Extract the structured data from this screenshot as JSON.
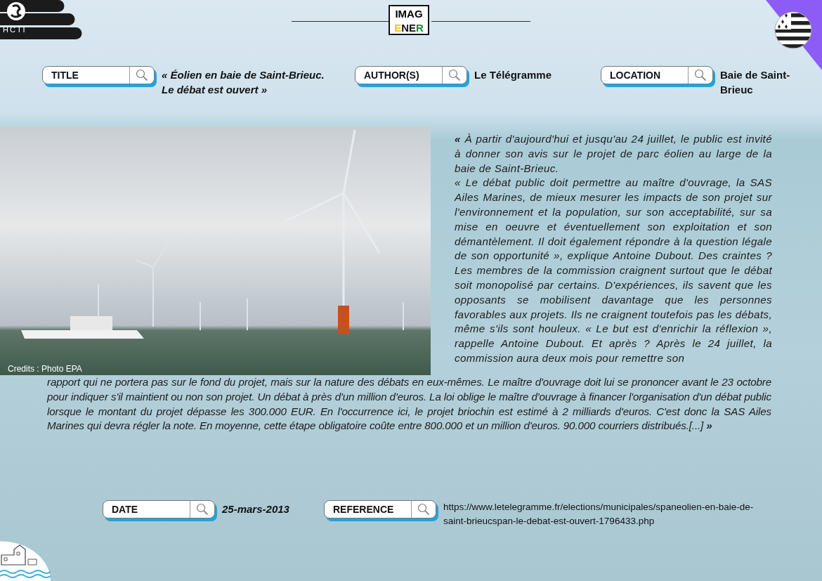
{
  "logo_left": {
    "text": "HCTI"
  },
  "logo_center": {
    "line1": "IMAG",
    "line2": [
      {
        "text": "E",
        "color": "#f0c419"
      },
      {
        "text": "NE",
        "color": "#111111"
      },
      {
        "text": "R",
        "color": "#1f8a3b"
      }
    ]
  },
  "top_fields": [
    {
      "label": "TITLE",
      "value": "« Éolien en baie de Saint-Brieuc. Le débat est ouvert »",
      "italic": true
    },
    {
      "label": "AUTHOR(S)",
      "value": "Le Télégramme",
      "italic": false
    },
    {
      "label": "LOCATION",
      "value": "Baie de Saint-Brieuc",
      "italic": false
    }
  ],
  "photo": {
    "credit": "Credits : Photo EPA"
  },
  "article": {
    "beside_photo": [
      "**«** À partir d'aujourd'hui et jusqu'au 24 juillet, le public est invité à donner son avis sur le projet de parc éolien au large de la baie de Saint-Brieuc.",
      "« Le débat public doit permettre au maître d'ouvrage, la SAS Ailes Marines, de mieux mesurer les impacts de son projet sur l'environnement et la population, sur son acceptabilité, sur sa mise en oeuvre et éventuellement son exploitation et son démantèlement. Il doit également répondre à la question légale de son opportunité », explique Antoine Dubout. Des craintes ? Les membres de la commission craignent surtout que le débat soit monopolisé par certains. D'expériences, ils savent que les opposants se mobilisent davantage que les personnes favorables aux projets. Ils ne craignent toutefois pas les débats, même s'ils sont houleux. « Le but est d'enrichir la réflexion », rappelle Antoine Dubout. Et après ? Après le 24 juillet, la commission aura deux mois pour remettre son"
    ],
    "below_photo": "rapport qui ne portera pas sur le fond du projet, mais sur la nature des débats en eux-mêmes. Le maître d'ouvrage doit lui se prononcer avant le 23 octobre pour indiquer s'il maintient ou non son projet. Un débat à près d'un million d'euros. La loi oblige le maître d'ouvrage à financer l'organisation d'un débat public lorsque le montant du projet dépasse les 300.000 EUR. En l'occurrence ici, le projet briochin est estimé à 2 milliards d'euros. C'est donc la SAS Ailes Marines qui devra régler la note. En moyenne, cette étape obligatoire coûte entre 800.000 et un million d'euros. 90.000 courriers distribués.[...] **»**"
  },
  "bottom_fields": [
    {
      "label": "DATE",
      "value": "25-mars-2013",
      "italic": true
    },
    {
      "label": "REFERENCE",
      "value": "https://www.letelegramme.fr/elections/municipales/spaneolien-en-baie-de-saint-brieucspan-le-debat-est-ouvert-1796433.php",
      "italic": false
    }
  ]
}
